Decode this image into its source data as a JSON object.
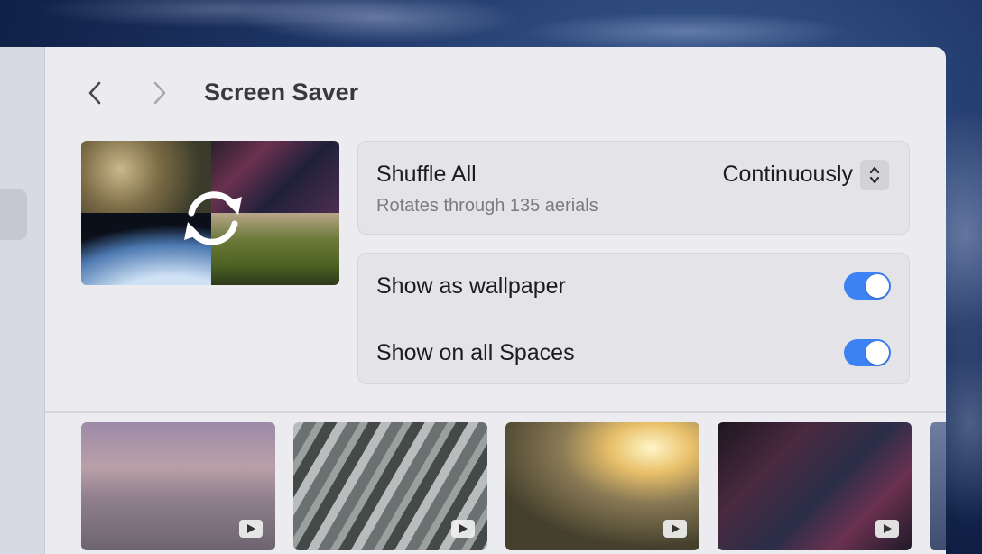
{
  "window": {
    "title": "Screen Saver"
  },
  "nav": {
    "back_icon": "chevron-left-icon",
    "forward_icon": "chevron-right-icon"
  },
  "preview": {
    "icon": "refresh-icon"
  },
  "shuffle": {
    "title": "Shuffle All",
    "subtitle": "Rotates through 135 aerials",
    "frequency_value": "Continuously",
    "stepper_icon": "up-down-chevrons-icon"
  },
  "options": [
    {
      "label": "Show as wallpaper",
      "enabled": true
    },
    {
      "label": "Show on all Spaces",
      "enabled": true
    }
  ],
  "thumbnails": [
    {
      "name": "dubai-skyline",
      "badge_icon": "play-icon"
    },
    {
      "name": "highway-interchange",
      "badge_icon": "play-icon"
    },
    {
      "name": "sunset-city",
      "badge_icon": "play-icon"
    },
    {
      "name": "night-city-aerial",
      "badge_icon": "play-icon"
    }
  ],
  "colors": {
    "accent": "#3d82f4",
    "panel_bg": "#ececf0",
    "group_bg": "#e3e3e8"
  }
}
